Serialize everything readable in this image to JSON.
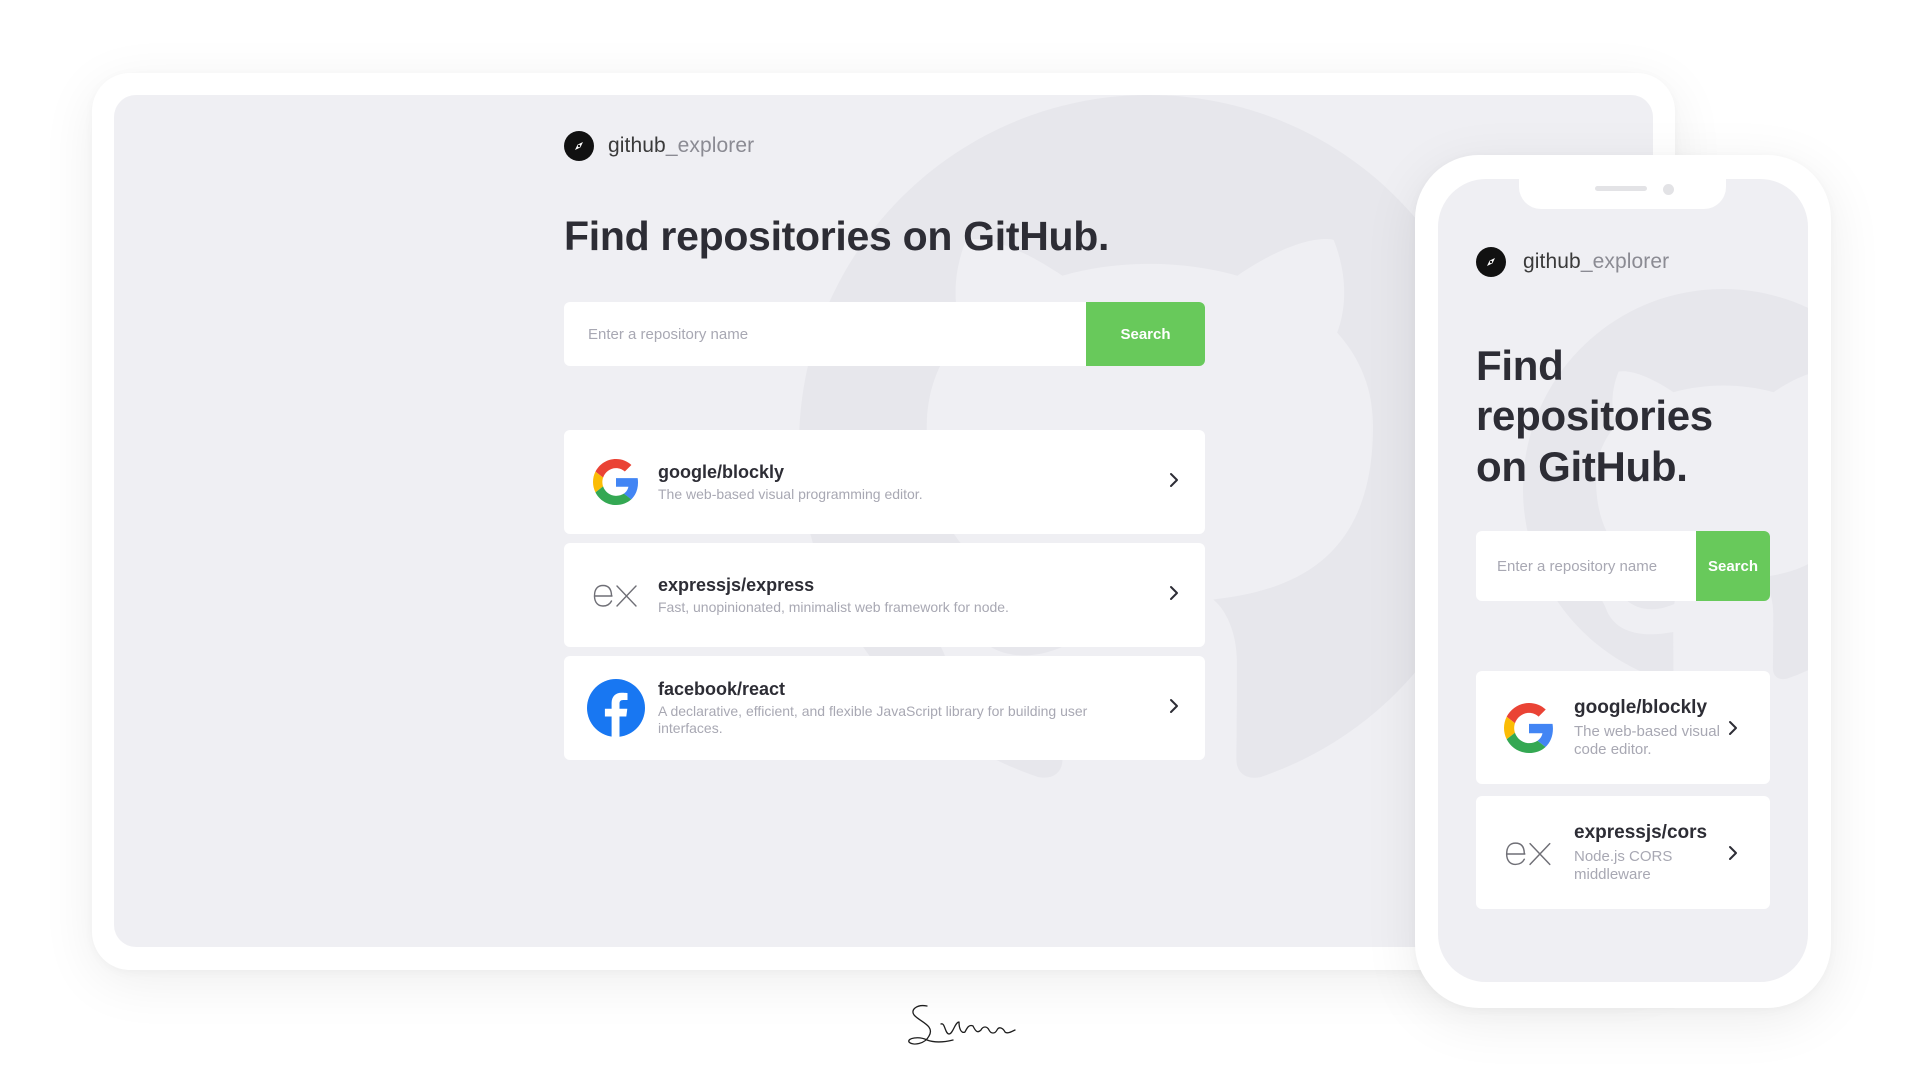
{
  "desktop": {
    "brand": {
      "bold": "github",
      "light": "_explorer"
    },
    "hero_title": "Find repositories on GitHub.",
    "search": {
      "placeholder": "Enter a repository name",
      "button_label": "Search"
    },
    "repositories": [
      {
        "name": "google/blockly",
        "description": "The web-based visual programming editor.",
        "logo": "google-logo-icon"
      },
      {
        "name": "expressjs/express",
        "description": "Fast, unopinionated, minimalist web framework for node.",
        "logo": "express-logo-icon"
      },
      {
        "name": "facebook/react",
        "description": "A declarative, efficient, and flexible JavaScript library for building user interfaces.",
        "logo": "facebook-logo-icon"
      }
    ]
  },
  "mobile": {
    "brand": {
      "bold": "github",
      "light": "_explorer"
    },
    "hero_title": "Find repositories on GitHub.",
    "search": {
      "placeholder": "Enter a repository name",
      "button_label": "Search"
    },
    "repositories": [
      {
        "name": "google/blockly",
        "description": "The web-based visual code editor.",
        "logo": "google-logo-icon"
      },
      {
        "name": "expressjs/cors",
        "description": "Node.js CORS middleware",
        "logo": "express-logo-icon"
      }
    ]
  },
  "colors": {
    "accent": "#68c95b",
    "screen_background": "#efeff3",
    "title_text": "#2d2d35",
    "muted_text": "#a8a8b3"
  },
  "signature": "Silvon"
}
